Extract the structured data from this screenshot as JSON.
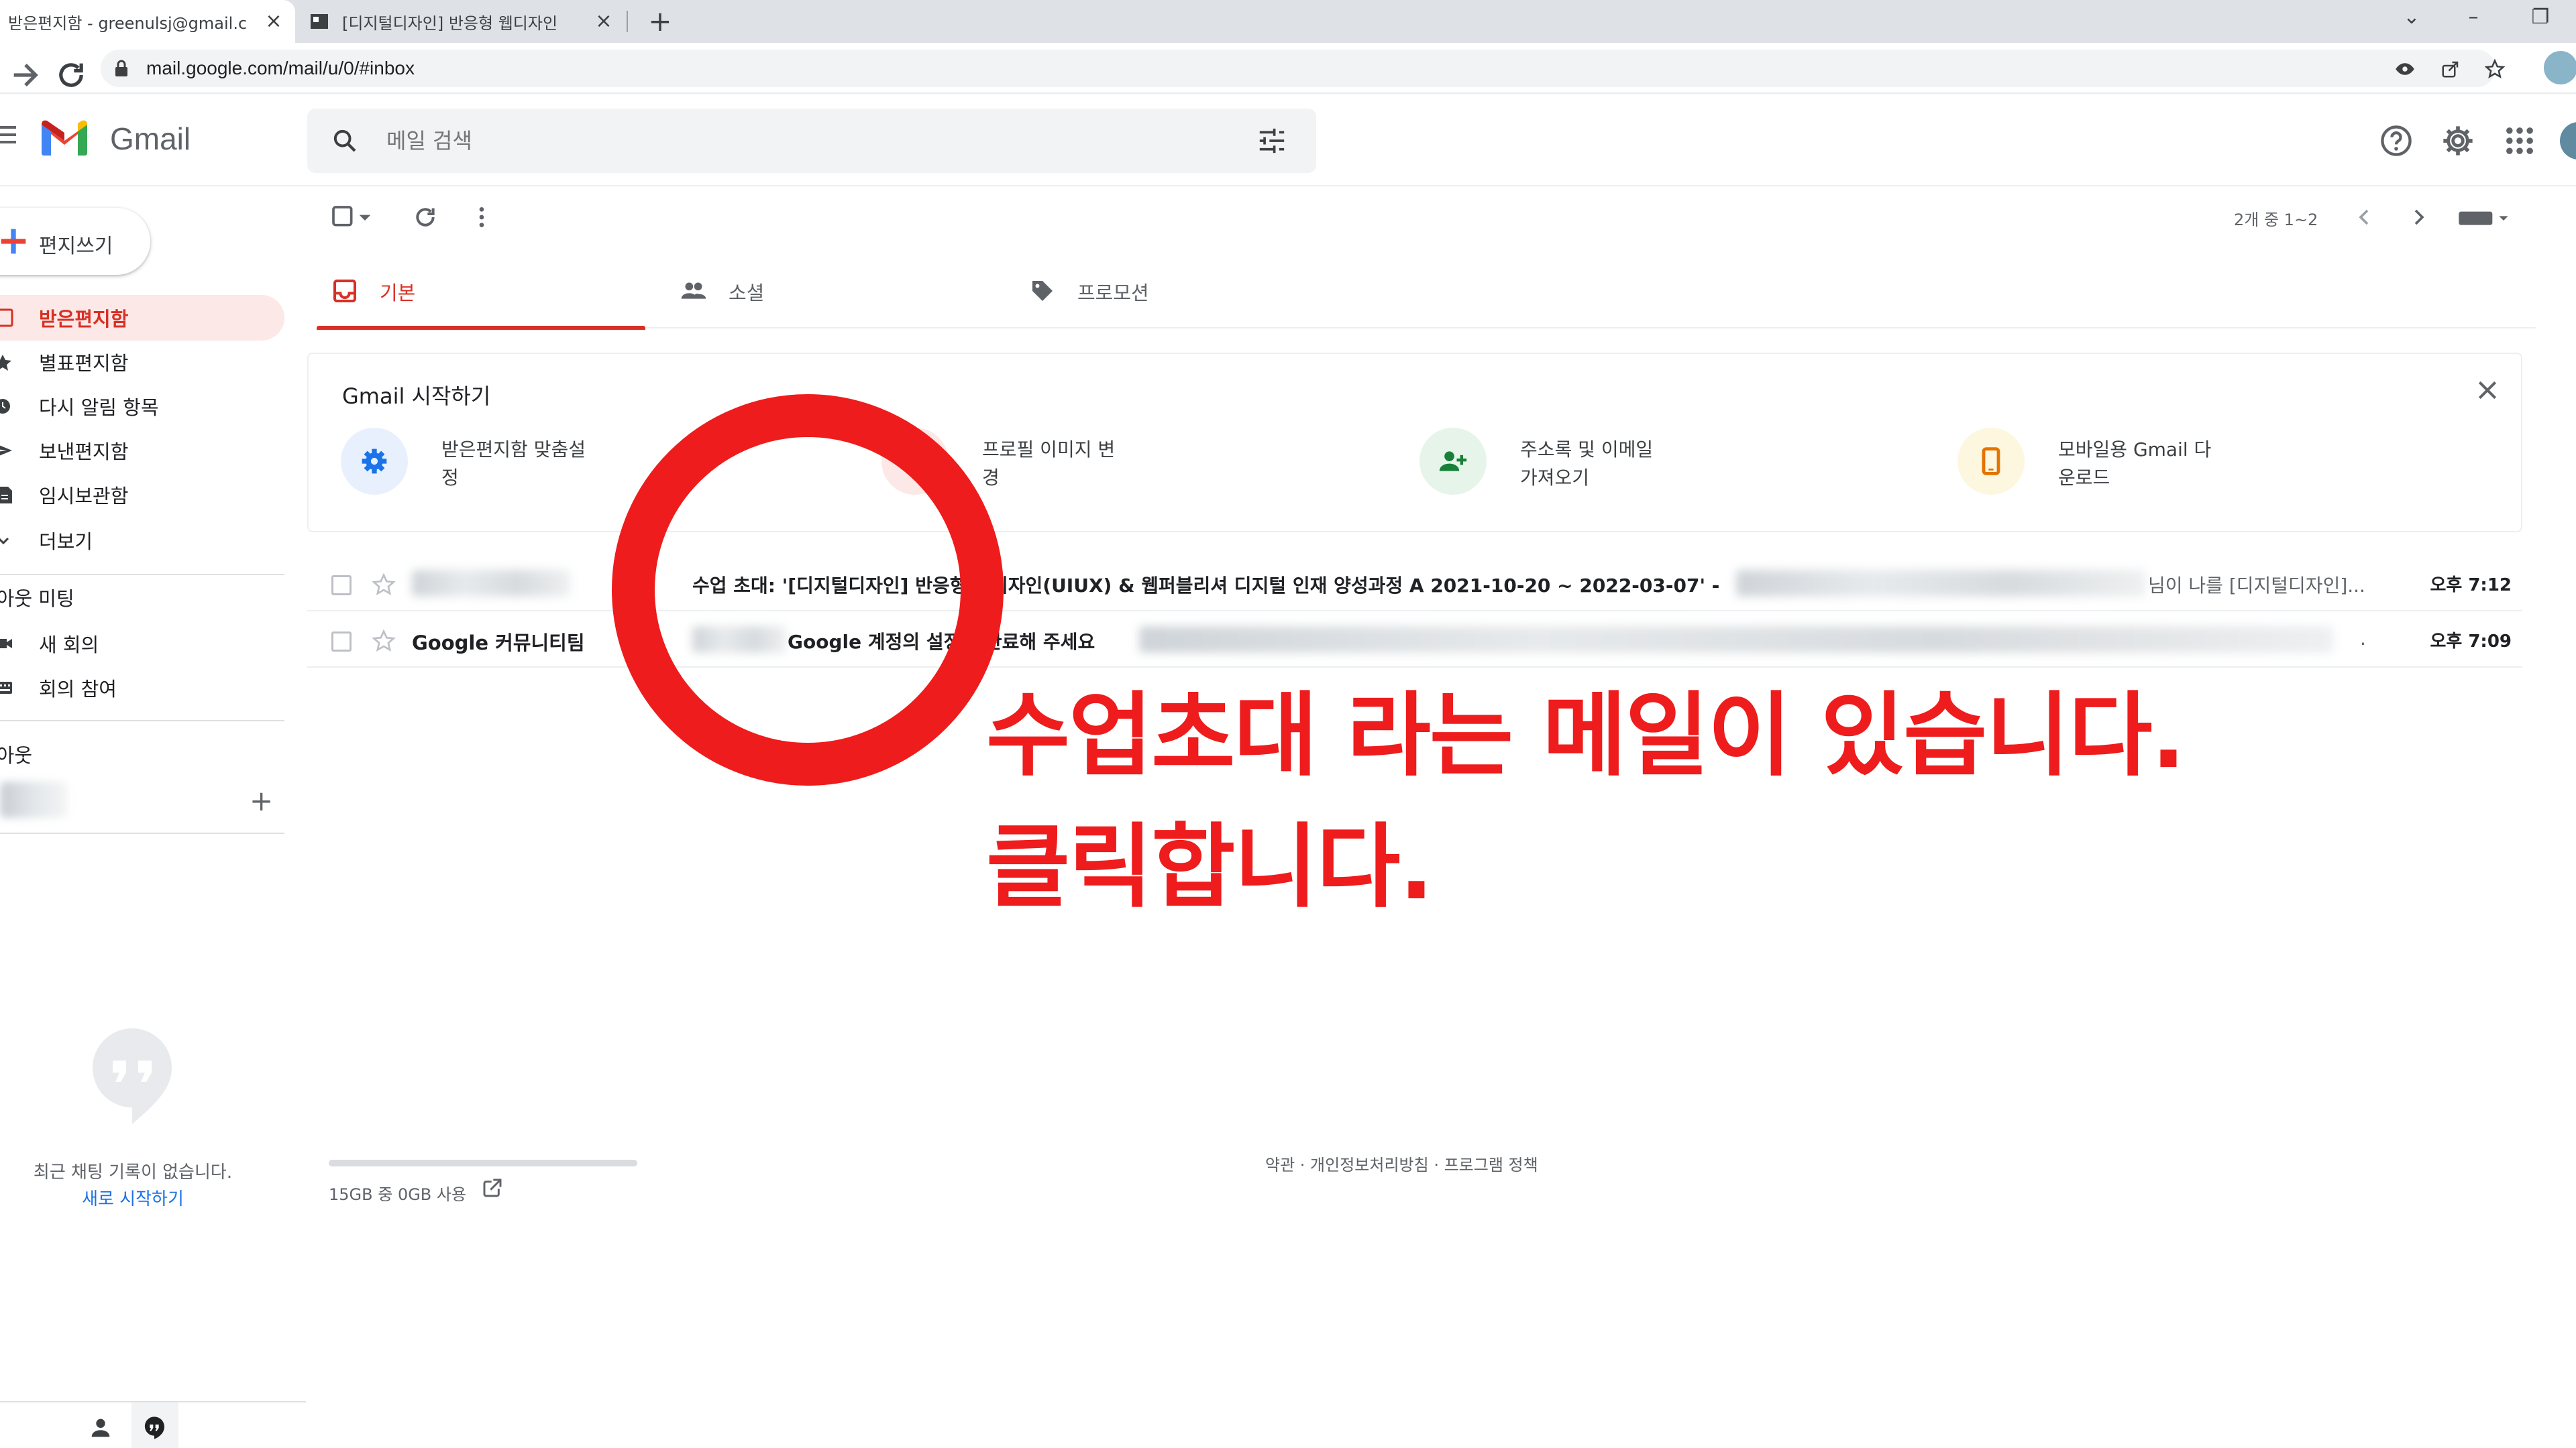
{
  "browser": {
    "tabs": [
      {
        "title": "받은편지함 - greenulsj@gmail.c",
        "close": "×"
      },
      {
        "title": "[디지털디자인] 반응형 웹디자인",
        "close": "×"
      }
    ],
    "new_tab": "+",
    "url": "mail.google.com/mail/u/0/#inbox",
    "controls": {
      "min": "–",
      "restore": "❐",
      "dropdown": "⌄"
    }
  },
  "header": {
    "brand": "Gmail",
    "search_placeholder": "메일 검색"
  },
  "sidebar": {
    "compose": "편지쓰기",
    "items": [
      {
        "label": "받은편지함",
        "active": true,
        "icon": "inbox-icon"
      },
      {
        "label": "별표편지함",
        "icon": "star-icon"
      },
      {
        "label": "다시 알림 항목",
        "icon": "clock-icon"
      },
      {
        "label": "보낸편지함",
        "icon": "send-icon"
      },
      {
        "label": "임시보관함",
        "icon": "draft-icon"
      },
      {
        "label": "더보기",
        "icon": "chevron-down-icon"
      }
    ],
    "meet_heading": "행아웃 미팅",
    "meet_items": [
      {
        "label": "새 회의",
        "icon": "video-icon"
      },
      {
        "label": "회의 참여",
        "icon": "keyboard-icon"
      }
    ],
    "hangouts_heading": "행아웃",
    "hangouts_add": "+",
    "no_chat": "최근 채팅 기록이 없습니다.",
    "start_new": "새로 시작하기"
  },
  "toolbar": {
    "pager": "2개 중 1~2"
  },
  "tabs": [
    {
      "label": "기본",
      "active": true,
      "icon": "inbox-icon"
    },
    {
      "label": "소셜",
      "icon": "people-icon"
    },
    {
      "label": "프로모션",
      "icon": "tag-icon"
    }
  ],
  "getting_started": {
    "title": "Gmail 시작하기",
    "items": [
      {
        "line1": "받은편지함 맞춤설",
        "line2": "정",
        "icon": "gear-icon",
        "color": "#1a73e8"
      },
      {
        "line1": "프로필 이미지 변",
        "line2": "경",
        "icon": "profile-icon",
        "color": "#d93025"
      },
      {
        "line1": "주소록 및 이메일",
        "line2": "가져오기",
        "icon": "add-contact-icon",
        "color": "#188038"
      },
      {
        "line1": "모바일용 Gmail 다",
        "line2": "운로드",
        "icon": "phone-icon",
        "color": "#e37400"
      }
    ]
  },
  "emails": [
    {
      "subject": "수업 초대: '[디지털디자인] 반응형 웹디자인(UIUX) & 웹퍼블리셔 디지털 인재 양성과정 A 2021-10-20 ~ 2022-03-07' -",
      "snippet": "님이 나를 [디지털디자인]...",
      "time": "오후 7:12"
    },
    {
      "sender": "Google 커뮤니티팀",
      "subject": "Google 계정의 설정을 완료해 주세요",
      "snippet": ".",
      "time": "오후 7:09"
    }
  ],
  "footer": {
    "storage": "15GB 중 0GB 사용",
    "links": "약관 · 개인정보처리방침 · 프로그램 정책"
  },
  "annotation": {
    "line1": "수업초대 라는 메일이 있습니다.",
    "line2": "클릭합니다.",
    "color": "#ee1c1c"
  }
}
